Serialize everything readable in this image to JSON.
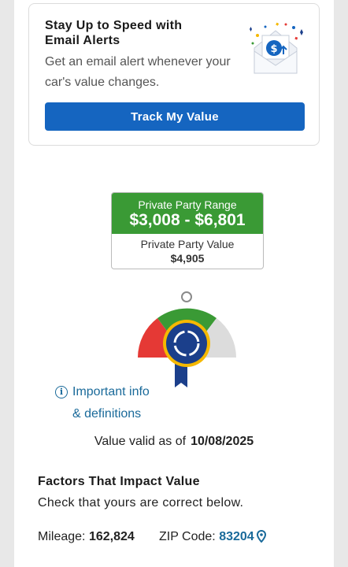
{
  "email_alert": {
    "title": "Stay Up to Speed with Email Alerts",
    "description": "Get an email alert whenever your car's value changes.",
    "button_label": "Track My Value",
    "art_icon": "envelope-dollar-icon"
  },
  "valuation": {
    "range_label": "Private Party Range",
    "range_value": "$3,008 - $6,801",
    "value_label": "Private Party Value",
    "value": "$4,905"
  },
  "gauge": {
    "icon": "value-ribbon-icon",
    "colors": {
      "low": "#e53935",
      "mid": "#3a9a35",
      "high": "#d9d9d9",
      "ribbon": "#1b3f8b",
      "ribbon_ring": "#f5b800"
    }
  },
  "info_link": {
    "line1": "Important info",
    "line2": "& definitions"
  },
  "validity": {
    "label": "Value valid as of",
    "date": "10/08/2025"
  },
  "factors": {
    "title": "Factors That Impact Value",
    "subtitle": "Check that yours are correct below.",
    "mileage_label": "Mileage:",
    "mileage_value": "162,824",
    "zip_label": "ZIP Code:",
    "zip_value": "83204"
  },
  "colors": {
    "accent_button": "#1565c0",
    "range_green": "#3a9a35",
    "link": "#1a6a9a"
  }
}
